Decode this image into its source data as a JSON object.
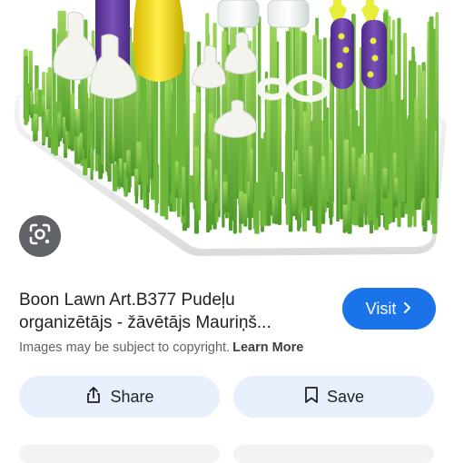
{
  "result": {
    "title": "Boon Lawn Art.B377 Pudeļu organizētājs - žāvētājs Mauriņš...",
    "visit_label": "Visit",
    "copyright_text": "Images may be subject to copyright.",
    "learn_more_label": "Learn More"
  },
  "actions": {
    "share_label": "Share",
    "save_label": "Save"
  },
  "icons": {
    "lens": "google-lens-icon",
    "visit_arrow": "chevron-right-icon",
    "share": "share-icon",
    "save": "bookmark-icon"
  },
  "colors": {
    "accent": "#1a73e8",
    "action_bg": "#e8f0fe",
    "lens_bg": "#5f6368",
    "grass": "#7cc242",
    "tray": "#ffffff"
  }
}
